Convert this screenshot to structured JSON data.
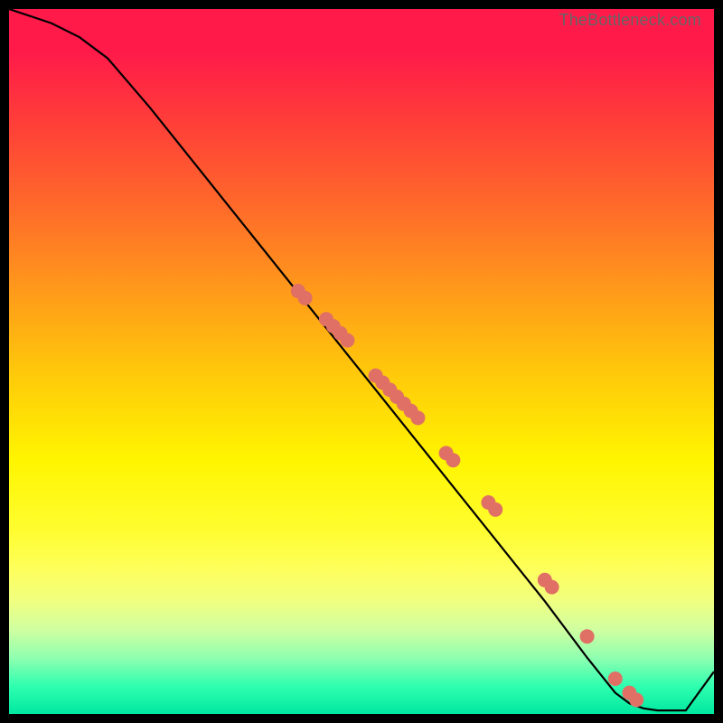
{
  "watermark": "TheBottleneck.com",
  "colors": {
    "dot_fill": "#e07066",
    "dot_stroke": "#cc5a50",
    "line": "#000000"
  },
  "chart_data": {
    "type": "line",
    "title": "",
    "xlabel": "",
    "ylabel": "",
    "xlim": [
      0,
      100
    ],
    "ylim": [
      0,
      100
    ],
    "series": [
      {
        "name": "curve",
        "x": [
          0,
          6,
          10,
          14,
          20,
          28,
          36,
          44,
          52,
          60,
          68,
          76,
          82,
          86,
          88,
          90,
          92,
          96,
          100
        ],
        "y": [
          100,
          98,
          96,
          93,
          86,
          76,
          66,
          56,
          46,
          36,
          26,
          16,
          8,
          3,
          1.5,
          0.8,
          0.5,
          0.5,
          6
        ]
      }
    ],
    "scatter": {
      "name": "highlighted-points",
      "x": [
        41,
        42,
        45,
        46,
        47,
        48,
        52,
        53,
        54,
        55,
        56,
        57,
        58,
        62,
        63,
        68,
        69,
        76,
        77,
        82,
        86,
        88,
        89
      ],
      "y": [
        60,
        59,
        56,
        55,
        54,
        53,
        48,
        47,
        46,
        45,
        44,
        43,
        42,
        37,
        36,
        30,
        29,
        19,
        18,
        11,
        5,
        3,
        2
      ]
    }
  }
}
